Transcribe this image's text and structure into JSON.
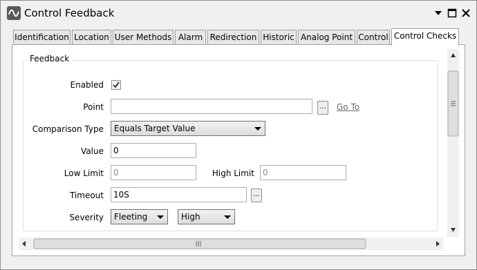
{
  "window": {
    "title": "Control Feedback"
  },
  "tabs": [
    {
      "label": "Identification"
    },
    {
      "label": "Location"
    },
    {
      "label": "User Methods"
    },
    {
      "label": "Alarm"
    },
    {
      "label": "Redirection"
    },
    {
      "label": "Historic"
    },
    {
      "label": "Analog Point"
    },
    {
      "label": "Control"
    },
    {
      "label": "Control Checks",
      "active": true
    }
  ],
  "feedback": {
    "group_title": "Feedback",
    "enabled_label": "Enabled",
    "enabled_checked": true,
    "point_label": "Point",
    "point_value": "",
    "browse_label": "...",
    "goto_label": "Go To",
    "comparison_label": "Comparison Type",
    "comparison_value": "Equals Target Value",
    "value_label": "Value",
    "value_value": "0",
    "low_limit_label": "Low Limit",
    "low_limit_value": "0",
    "high_limit_label": "High Limit",
    "high_limit_value": "0",
    "timeout_label": "Timeout",
    "timeout_value": "10S",
    "severity_label": "Severity",
    "severity_value": "Fleeting",
    "severity_level_value": "High"
  },
  "icons": {
    "app": "trend-icon",
    "dropdown": "chevron-down-icon",
    "maximize": "maximize-icon",
    "close": "close-icon"
  }
}
